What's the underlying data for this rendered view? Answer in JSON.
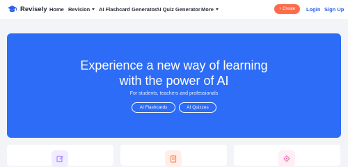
{
  "brand": {
    "name": "Revisely",
    "color": "#2a5fe8"
  },
  "nav": {
    "home": "Home",
    "revision": "Revision",
    "flashcard_generator": "AI Flashcard Generator",
    "quiz_generator": "AI Quiz Generator",
    "more": "More",
    "create": "+ Create",
    "login": "Login",
    "signup": "Sign Up"
  },
  "hero": {
    "title_line1": "Experience a new way of learning",
    "title_line2": "with the power of AI",
    "subtitle": "For students, teachers and professionals",
    "btn_flashcards": "AI Flashcards",
    "btn_quizzes": "AI Quizzes",
    "background": "#2d6cf6"
  },
  "cards": [
    {
      "icon": "edit-icon",
      "color": "#a78bfa"
    },
    {
      "icon": "document-icon",
      "color": "#fb8b5b"
    },
    {
      "icon": "shapes-icon",
      "color": "#f472b6"
    }
  ]
}
